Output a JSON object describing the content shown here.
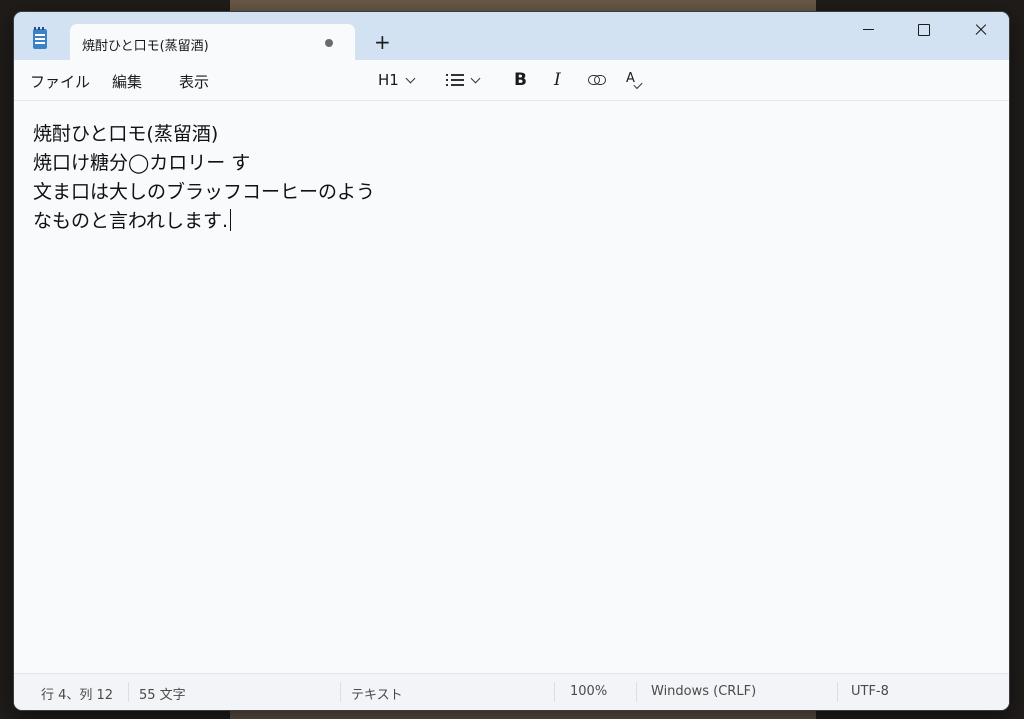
{
  "tab": {
    "title": "焼酎ひと口モ(蒸留酒)",
    "new_tab": "+"
  },
  "menu": {
    "file": "ファイル",
    "edit": "編集",
    "view": "表示"
  },
  "toolbar": {
    "heading": "H1",
    "bold": "B",
    "italic": "I",
    "spell": "A"
  },
  "document": {
    "lines": [
      "焼酎ひと口モ(蒸留酒)",
      "焼口け糖分◯カロリー す",
      "文ま口は大しのブラッフコーヒーのよう",
      "なものと言われします."
    ]
  },
  "status": {
    "position": "行 4、列 12",
    "chars": "55 文字",
    "format": "テキスト",
    "zoom": "100%",
    "line_ending": "Windows (CRLF)",
    "encoding": "UTF-8"
  },
  "icons": {
    "app": "notepad-icon",
    "list": "bulleted-list-icon",
    "link": "link-icon",
    "spell": "spell-check-icon",
    "settings": "gear-icon"
  },
  "colors": {
    "titlebar": "#d2e2f2",
    "background": "#f9fafc",
    "accent": "#3b82c9"
  }
}
